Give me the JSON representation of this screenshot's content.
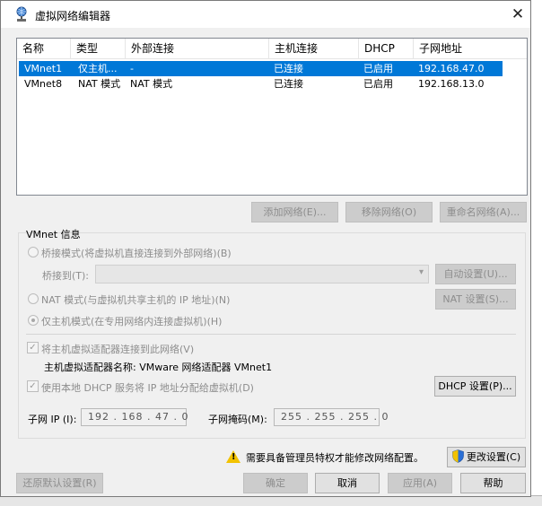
{
  "window": {
    "title": "虚拟网络编辑器",
    "app_icon": "vmware-network-icon",
    "close_icon": "close-icon",
    "close_glyph": "✕"
  },
  "table": {
    "columns": [
      "名称",
      "类型",
      "外部连接",
      "主机连接",
      "DHCP",
      "子网地址"
    ],
    "rows": [
      {
        "name": "VMnet1",
        "type": "仅主机...",
        "external": "-",
        "host": "已连接",
        "dhcp": "已启用",
        "subnet": "192.168.47.0",
        "selected": true
      },
      {
        "name": "VMnet8",
        "type": "NAT 模式",
        "external": "NAT 模式",
        "host": "已连接",
        "dhcp": "已启用",
        "subnet": "192.168.13.0",
        "selected": false
      }
    ]
  },
  "table_buttons": {
    "add": "添加网络(E)...",
    "remove": "移除网络(O)",
    "rename": "重命名网络(A)..."
  },
  "vmnet_info": {
    "group_label": "VMnet 信息",
    "bridged_label": "桥接模式(将虚拟机直接连接到外部网络)(B)",
    "bridge_to_label": "桥接到(T):",
    "bridge_to_value": "",
    "auto_settings": "自动设置(U)...",
    "nat_label": "NAT 模式(与虚拟机共享主机的 IP 地址)(N)",
    "nat_settings": "NAT 设置(S)...",
    "hostonly_label": "仅主机模式(在专用网络内连接虚拟机)(H)",
    "connect_adapter_label": "将主机虚拟适配器连接到此网络(V)",
    "adapter_name": "主机虚拟适配器名称: VMware 网络适配器 VMnet1",
    "dhcp_label": "使用本地 DHCP 服务将 IP 地址分配给虚拟机(D)",
    "dhcp_settings": "DHCP 设置(P)...",
    "subnet_ip_label": "子网 IP (I):",
    "subnet_ip": "192 . 168 . 47 . 0",
    "subnet_mask_label": "子网掩码(M):",
    "subnet_mask": "255 . 255 . 255 . 0",
    "selected_mode": "host-only",
    "checkmark": "✓"
  },
  "footer": {
    "warning_text": "需要具备管理员特权才能修改网络配置。",
    "warning_icon": "warning-icon",
    "warning_glyph": "!",
    "change_settings": "更改设置(C)",
    "restore_defaults": "还原默认设置(R)",
    "ok": "确定",
    "cancel": "取消",
    "apply": "应用(A)",
    "help": "帮助"
  },
  "colors": {
    "selection": "#0078d7",
    "dialog_bg": "#f0f0f0",
    "warning": "#f2c200",
    "shield_blue": "#2a6fd6"
  }
}
